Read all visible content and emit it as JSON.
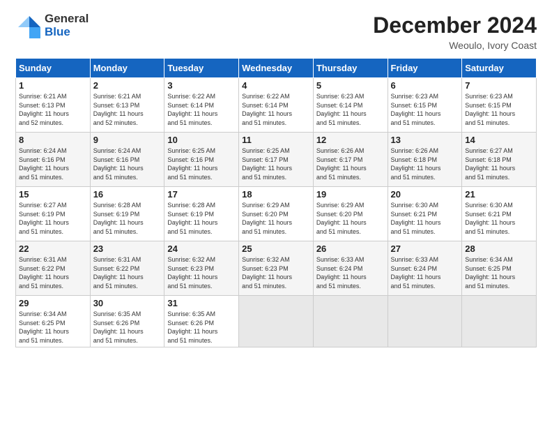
{
  "logo": {
    "general": "General",
    "blue": "Blue"
  },
  "title": "December 2024",
  "subtitle": "Weoulo, Ivory Coast",
  "header_days": [
    "Sunday",
    "Monday",
    "Tuesday",
    "Wednesday",
    "Thursday",
    "Friday",
    "Saturday"
  ],
  "weeks": [
    [
      {
        "day": "1",
        "info": "Sunrise: 6:21 AM\nSunset: 6:13 PM\nDaylight: 11 hours\nand 52 minutes."
      },
      {
        "day": "2",
        "info": "Sunrise: 6:21 AM\nSunset: 6:13 PM\nDaylight: 11 hours\nand 52 minutes."
      },
      {
        "day": "3",
        "info": "Sunrise: 6:22 AM\nSunset: 6:14 PM\nDaylight: 11 hours\nand 51 minutes."
      },
      {
        "day": "4",
        "info": "Sunrise: 6:22 AM\nSunset: 6:14 PM\nDaylight: 11 hours\nand 51 minutes."
      },
      {
        "day": "5",
        "info": "Sunrise: 6:23 AM\nSunset: 6:14 PM\nDaylight: 11 hours\nand 51 minutes."
      },
      {
        "day": "6",
        "info": "Sunrise: 6:23 AM\nSunset: 6:15 PM\nDaylight: 11 hours\nand 51 minutes."
      },
      {
        "day": "7",
        "info": "Sunrise: 6:23 AM\nSunset: 6:15 PM\nDaylight: 11 hours\nand 51 minutes."
      }
    ],
    [
      {
        "day": "8",
        "info": "Sunrise: 6:24 AM\nSunset: 6:16 PM\nDaylight: 11 hours\nand 51 minutes."
      },
      {
        "day": "9",
        "info": "Sunrise: 6:24 AM\nSunset: 6:16 PM\nDaylight: 11 hours\nand 51 minutes."
      },
      {
        "day": "10",
        "info": "Sunrise: 6:25 AM\nSunset: 6:16 PM\nDaylight: 11 hours\nand 51 minutes."
      },
      {
        "day": "11",
        "info": "Sunrise: 6:25 AM\nSunset: 6:17 PM\nDaylight: 11 hours\nand 51 minutes."
      },
      {
        "day": "12",
        "info": "Sunrise: 6:26 AM\nSunset: 6:17 PM\nDaylight: 11 hours\nand 51 minutes."
      },
      {
        "day": "13",
        "info": "Sunrise: 6:26 AM\nSunset: 6:18 PM\nDaylight: 11 hours\nand 51 minutes."
      },
      {
        "day": "14",
        "info": "Sunrise: 6:27 AM\nSunset: 6:18 PM\nDaylight: 11 hours\nand 51 minutes."
      }
    ],
    [
      {
        "day": "15",
        "info": "Sunrise: 6:27 AM\nSunset: 6:19 PM\nDaylight: 11 hours\nand 51 minutes."
      },
      {
        "day": "16",
        "info": "Sunrise: 6:28 AM\nSunset: 6:19 PM\nDaylight: 11 hours\nand 51 minutes."
      },
      {
        "day": "17",
        "info": "Sunrise: 6:28 AM\nSunset: 6:19 PM\nDaylight: 11 hours\nand 51 minutes."
      },
      {
        "day": "18",
        "info": "Sunrise: 6:29 AM\nSunset: 6:20 PM\nDaylight: 11 hours\nand 51 minutes."
      },
      {
        "day": "19",
        "info": "Sunrise: 6:29 AM\nSunset: 6:20 PM\nDaylight: 11 hours\nand 51 minutes."
      },
      {
        "day": "20",
        "info": "Sunrise: 6:30 AM\nSunset: 6:21 PM\nDaylight: 11 hours\nand 51 minutes."
      },
      {
        "day": "21",
        "info": "Sunrise: 6:30 AM\nSunset: 6:21 PM\nDaylight: 11 hours\nand 51 minutes."
      }
    ],
    [
      {
        "day": "22",
        "info": "Sunrise: 6:31 AM\nSunset: 6:22 PM\nDaylight: 11 hours\nand 51 minutes."
      },
      {
        "day": "23",
        "info": "Sunrise: 6:31 AM\nSunset: 6:22 PM\nDaylight: 11 hours\nand 51 minutes."
      },
      {
        "day": "24",
        "info": "Sunrise: 6:32 AM\nSunset: 6:23 PM\nDaylight: 11 hours\nand 51 minutes."
      },
      {
        "day": "25",
        "info": "Sunrise: 6:32 AM\nSunset: 6:23 PM\nDaylight: 11 hours\nand 51 minutes."
      },
      {
        "day": "26",
        "info": "Sunrise: 6:33 AM\nSunset: 6:24 PM\nDaylight: 11 hours\nand 51 minutes."
      },
      {
        "day": "27",
        "info": "Sunrise: 6:33 AM\nSunset: 6:24 PM\nDaylight: 11 hours\nand 51 minutes."
      },
      {
        "day": "28",
        "info": "Sunrise: 6:34 AM\nSunset: 6:25 PM\nDaylight: 11 hours\nand 51 minutes."
      }
    ],
    [
      {
        "day": "29",
        "info": "Sunrise: 6:34 AM\nSunset: 6:25 PM\nDaylight: 11 hours\nand 51 minutes."
      },
      {
        "day": "30",
        "info": "Sunrise: 6:35 AM\nSunset: 6:26 PM\nDaylight: 11 hours\nand 51 minutes."
      },
      {
        "day": "31",
        "info": "Sunrise: 6:35 AM\nSunset: 6:26 PM\nDaylight: 11 hours\nand 51 minutes."
      },
      {
        "day": "",
        "info": ""
      },
      {
        "day": "",
        "info": ""
      },
      {
        "day": "",
        "info": ""
      },
      {
        "day": "",
        "info": ""
      }
    ]
  ]
}
